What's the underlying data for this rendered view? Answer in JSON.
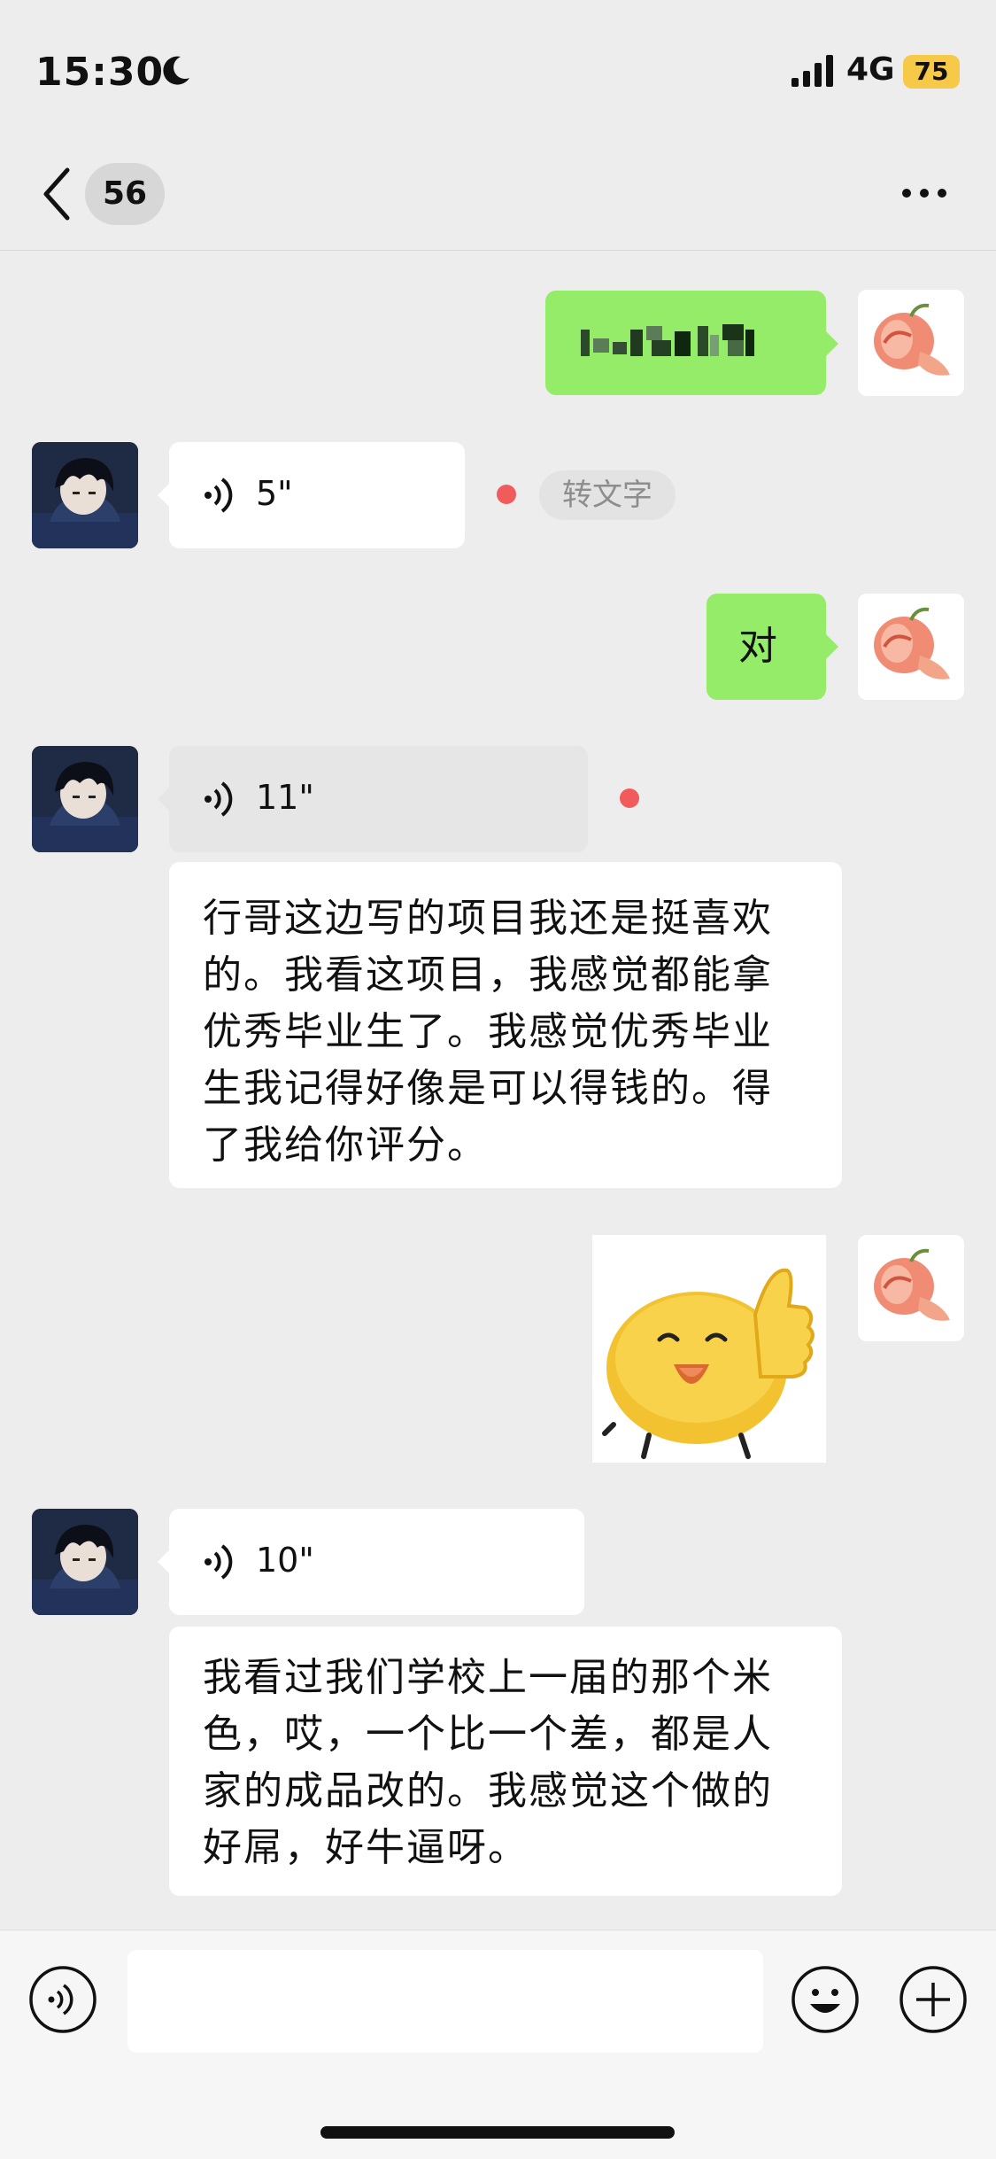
{
  "status_bar": {
    "time": "15:30",
    "network": "4G",
    "battery": "75",
    "battery_color": "#f7c948"
  },
  "nav": {
    "unread_count": "56",
    "back_icon": "chevron-left-icon",
    "more_icon": "ellipsis-icon"
  },
  "colors": {
    "sent_bubble": "#95ec69",
    "received_bubble": "#ffffff",
    "unread_dot": "#f15b5b",
    "background": "#ededed"
  },
  "messages": [
    {
      "type": "text",
      "side": "right",
      "text": "(pixelated/obscured content)"
    },
    {
      "type": "voice",
      "side": "left",
      "duration": "5\"",
      "unread": true,
      "action": "转文字"
    },
    {
      "type": "text",
      "side": "right",
      "text": "对"
    },
    {
      "type": "voice",
      "side": "left",
      "duration": "11\"",
      "unread": true,
      "transcript": "行哥这边写的项目我还是挺喜欢的。我看这项目，我感觉都能拿优秀毕业生了。我感觉优秀毕业生我记得好像是可以得钱的。得了我给你评分。"
    },
    {
      "type": "sticker",
      "side": "right",
      "description": "thumbs-up smiling blob"
    },
    {
      "type": "voice",
      "side": "left",
      "duration": "10\"",
      "transcript": "我看过我们学校上一届的那个米色，哎，一个比一个差，都是人家的成品改的。我感觉这个做的好屌，好牛逼呀。"
    }
  ],
  "transcript_lines": {
    "m4": [
      "行哥这边写的项目我还是挺喜欢",
      "的。我看这项目，我感觉都能拿",
      "优秀毕业生了。我感觉优秀毕业",
      "生我记得好像是可以得钱的。得",
      "了我给你评分。"
    ],
    "m6": [
      "我看过我们学校上一届的那个米",
      "色，哎，一个比一个差，都是人",
      "家的成品改的。我感觉这个做的",
      "好屌，好牛逼呀。"
    ]
  },
  "input_bar": {
    "voice_icon": "voice-icon",
    "emoji_icon": "emoji-icon",
    "plus_icon": "plus-icon",
    "input_value": ""
  }
}
